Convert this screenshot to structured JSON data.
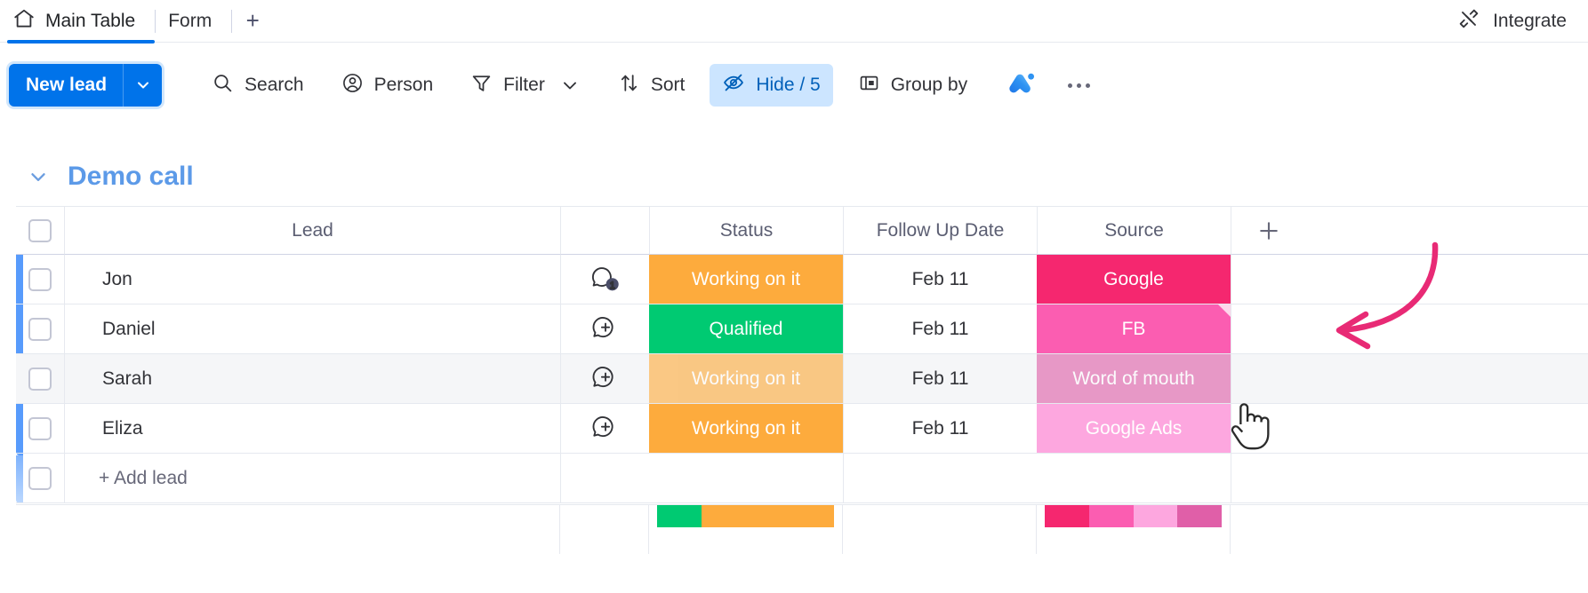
{
  "tabs": {
    "items": [
      {
        "label": "Main Table",
        "icon": "home-icon",
        "active": true
      },
      {
        "label": "Form",
        "icon": "",
        "active": false
      }
    ],
    "add_label": "+",
    "integrate_label": "Integrate",
    "integrate_icon": "integrate-plug-icon"
  },
  "toolbar": {
    "new_item_label": "New lead",
    "new_item_color": "#0073ea",
    "items": [
      {
        "label": "Search",
        "icon": "search-icon",
        "active": false,
        "caret": false
      },
      {
        "label": "Person",
        "icon": "person-icon",
        "active": false,
        "caret": false
      },
      {
        "label": "Filter",
        "icon": "filter-icon",
        "active": false,
        "caret": true
      },
      {
        "label": "Sort",
        "icon": "sort-icon",
        "active": false,
        "caret": false
      },
      {
        "label": "Hide / 5",
        "icon": "eye-slash-icon",
        "active": true,
        "caret": false
      },
      {
        "label": "Group by",
        "icon": "group-by-icon",
        "active": false,
        "caret": false
      }
    ],
    "ai_icon": "monday-ai-icon",
    "more_icon": "more-options-icon"
  },
  "group": {
    "title": "Demo call",
    "title_color": "#5c9ae8",
    "collapse_icon": "chevron-down-icon",
    "accent_color": "#579bfc"
  },
  "table": {
    "columns": [
      {
        "key": "lead",
        "label": "Lead"
      },
      {
        "key": "chat",
        "label": ""
      },
      {
        "key": "status",
        "label": "Status"
      },
      {
        "key": "date",
        "label": "Follow Up Date"
      },
      {
        "key": "source",
        "label": "Source"
      }
    ],
    "add_column_label": "+",
    "rows": [
      {
        "lead": "Jon",
        "chat_icon": "chat-badge-icon",
        "chat_count": "1",
        "status": {
          "label": "Working on it",
          "color": "#fdab3d"
        },
        "date": "Feb 11",
        "source": {
          "label": "Google",
          "color": "#f5276f",
          "fold": false
        },
        "hovered": false
      },
      {
        "lead": "Daniel",
        "chat_icon": "chat-add-icon",
        "chat_count": "",
        "status": {
          "label": "Qualified",
          "color": "#00ca72"
        },
        "date": "Feb 11",
        "source": {
          "label": "FB",
          "color": "#fb5db1",
          "fold": true
        },
        "hovered": false
      },
      {
        "lead": "Sarah",
        "chat_icon": "chat-add-icon",
        "chat_count": "",
        "status": {
          "label": "Working on it",
          "color": "#fdab3d"
        },
        "date": "Feb 11",
        "source": {
          "label": "Word of mouth",
          "color": "#e05fa8",
          "fold": false
        },
        "hovered": true
      },
      {
        "lead": "Eliza",
        "chat_icon": "chat-add-icon",
        "chat_count": "",
        "status": {
          "label": "Working on it",
          "color": "#fdab3d"
        },
        "date": "Feb 11",
        "source": {
          "label": "Google Ads",
          "color": "#fda7df",
          "fold": false
        },
        "hovered": false
      }
    ],
    "add_row_label": "+ Add lead"
  },
  "summary": {
    "status_segments": [
      {
        "color": "#00ca72",
        "percent": 25
      },
      {
        "color": "#fdab3d",
        "percent": 75
      }
    ],
    "source_segments": [
      {
        "color": "#f5276f",
        "percent": 25
      },
      {
        "color": "#fb5db1",
        "percent": 25
      },
      {
        "color": "#fda7df",
        "percent": 25
      },
      {
        "color": "#e05fa8",
        "percent": 25
      }
    ]
  },
  "annotation": {
    "arrow_color": "#e82a75",
    "name": "pink-curved-arrow"
  },
  "cursor": {
    "name": "hand-pointer-cursor"
  }
}
